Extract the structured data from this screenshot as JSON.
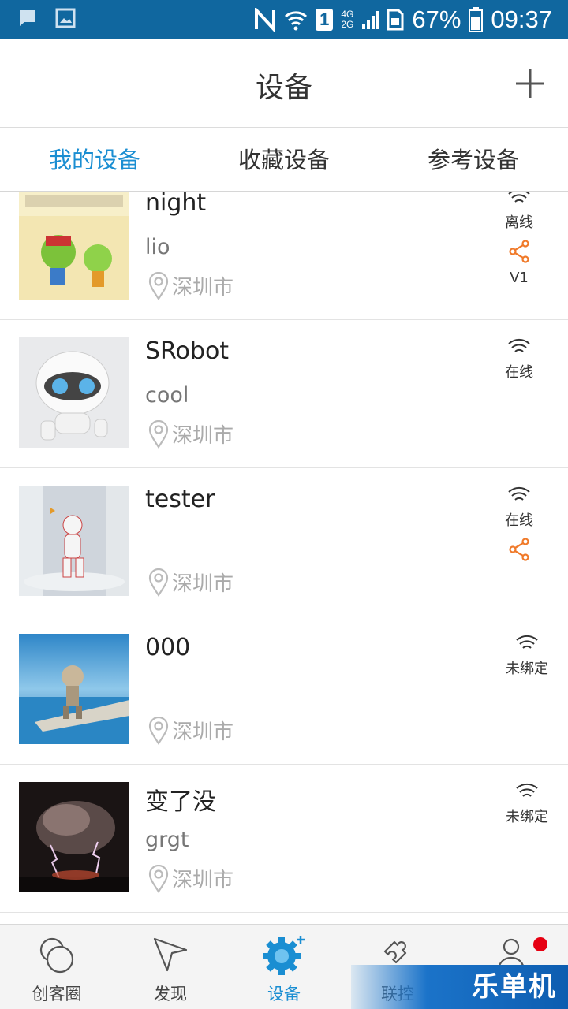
{
  "status_bar": {
    "battery": "67%",
    "time": "09:37",
    "sim": "1",
    "network_top": "4G",
    "network_bottom": "2G",
    "icons": [
      "chat-icon",
      "image-icon",
      "nfc-icon",
      "wifi-icon",
      "sim-icon",
      "signal-icon",
      "sim-card-icon",
      "battery-icon"
    ]
  },
  "header": {
    "title": "设备",
    "add_icon": "plus-icon"
  },
  "tabs": [
    {
      "label": "我的设备",
      "active": true
    },
    {
      "label": "收藏设备",
      "active": false
    },
    {
      "label": "参考设备",
      "active": false
    }
  ],
  "devices": [
    {
      "name": "night",
      "desc": "lio",
      "location": "深圳市",
      "status": "离线",
      "shared": true,
      "version": "V1",
      "thumb": "cartoon-thumbnail"
    },
    {
      "name": "SRobot",
      "desc": "cool",
      "location": "深圳市",
      "status": "在线",
      "shared": false,
      "version": "",
      "thumb": "robot-thumbnail"
    },
    {
      "name": "tester",
      "desc": "",
      "location": "深圳市",
      "status": "在线",
      "shared": true,
      "version": "",
      "thumb": "humanoid-robot-thumbnail"
    },
    {
      "name": "000",
      "desc": "",
      "location": "深圳市",
      "status": "未绑定",
      "shared": false,
      "version": "",
      "thumb": "sea-robot-thumbnail"
    },
    {
      "name": "变了没",
      "desc": "grgt",
      "location": "深圳市",
      "status": "未绑定",
      "shared": false,
      "version": "",
      "thumb": "storm-thumbnail"
    }
  ],
  "bottom_nav": [
    {
      "label": "创客圈",
      "icon": "circles-icon",
      "active": false
    },
    {
      "label": "发现",
      "icon": "navigation-arrow-icon",
      "active": false
    },
    {
      "label": "设备",
      "icon": "gear-plus-icon",
      "active": true
    },
    {
      "label": "联控",
      "icon": "puzzle-icon",
      "active": false
    },
    {
      "label": "",
      "icon": "user-icon",
      "active": false,
      "badge": true
    }
  ],
  "watermark": "乐单机",
  "colors": {
    "status_bar": "#10679f",
    "accent": "#1a8ed2",
    "share": "#f07a2a",
    "badge": "#e60012"
  }
}
